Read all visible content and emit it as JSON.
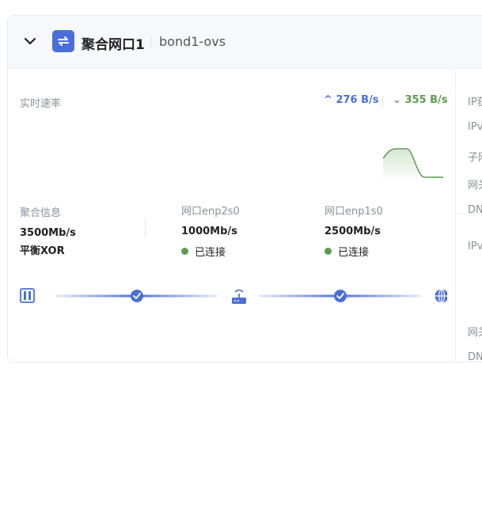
{
  "header": {
    "title": "聚合网口1",
    "subtitle": "bond1-ovs"
  },
  "realtime": {
    "label": "实时速率",
    "up": "276 B/s",
    "down": "355 B/s"
  },
  "bond_info": {
    "label": "聚合信息",
    "speed": "3500Mb/s",
    "mode": "平衡XOR"
  },
  "ports": [
    {
      "label": "网口enp2s0",
      "speed": "1000Mb/s",
      "status": "已连接"
    },
    {
      "label": "网口enp1s0",
      "speed": "2500Mb/s",
      "status": "已连接"
    }
  ],
  "right_panel": {
    "labels": [
      "IP获",
      "IPv",
      "子网",
      "网关",
      "DN",
      "IPv",
      "网关",
      "DN"
    ]
  },
  "colors": {
    "accent": "#4b6fd8",
    "download": "#5d9b4f",
    "connected": "#5d9b4f"
  }
}
